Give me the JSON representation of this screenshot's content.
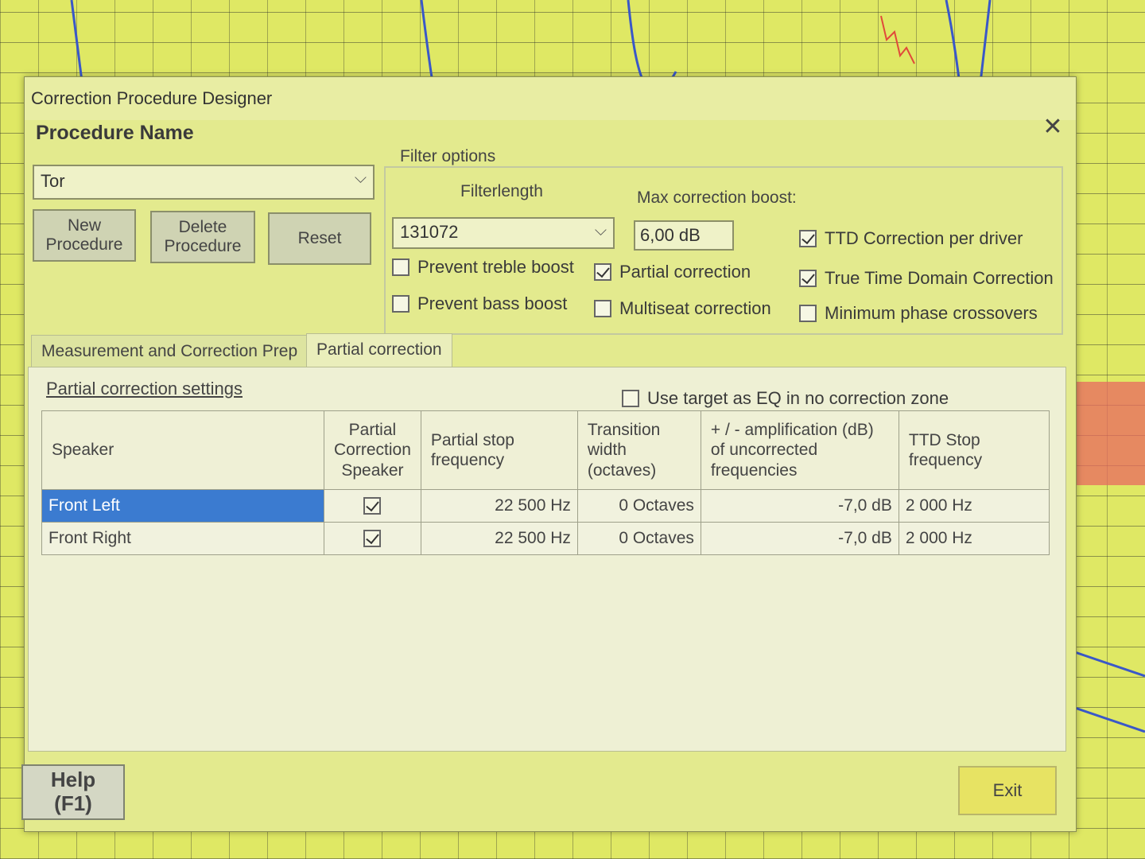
{
  "window": {
    "title": "Correction Procedure Designer"
  },
  "procedure": {
    "label": "Procedure Name",
    "selected": "Tor",
    "buttons": {
      "new": "New\nProcedure",
      "delete": "Delete\nProcedure",
      "reset": "Reset"
    }
  },
  "filter_options": {
    "legend": "Filter options",
    "filterlength_label": "Filterlength",
    "filterlength_value": "131072",
    "max_boost_label": "Max correction boost:",
    "max_boost_value": "6,00 dB",
    "checkboxes": {
      "prevent_treble": {
        "label": "Prevent treble boost",
        "checked": false
      },
      "prevent_bass": {
        "label": "Prevent bass boost",
        "checked": false
      },
      "partial": {
        "label": "Partial correction",
        "checked": true
      },
      "multiseat": {
        "label": "Multiseat correction",
        "checked": false
      },
      "ttd_per_driver": {
        "label": "TTD Correction per driver",
        "checked": true
      },
      "true_time": {
        "label": "True Time Domain Correction",
        "checked": true
      },
      "min_phase": {
        "label": "Minimum phase crossovers",
        "checked": false
      }
    }
  },
  "tabs": [
    "Measurement and Correction Prep",
    "Partial correction"
  ],
  "partial": {
    "settings_link": "Partial correction settings",
    "use_target": {
      "label": "Use target as EQ in no correction zone",
      "checked": false
    },
    "columns": [
      "Speaker",
      "Partial Correction Speaker",
      "Partial stop frequency",
      "Transition width (octaves)",
      "+ / - amplification (dB) of uncorrected frequencies",
      "TTD Stop frequency"
    ],
    "rows": [
      {
        "speaker": "Front Left",
        "partial": true,
        "stop": "22 500 Hz",
        "width": "0 Octaves",
        "amp": "-7,0 dB",
        "ttd": "2 000 Hz"
      },
      {
        "speaker": "Front Right",
        "partial": true,
        "stop": "22 500 Hz",
        "width": "0 Octaves",
        "amp": "-7,0 dB",
        "ttd": "2 000 Hz"
      }
    ]
  },
  "footer": {
    "help": "Help\n(F1)",
    "exit": "Exit"
  },
  "colors": {
    "selection": "#3b7bd0",
    "exit_button": "#e7e363",
    "graph_bg": "#dfe864"
  }
}
